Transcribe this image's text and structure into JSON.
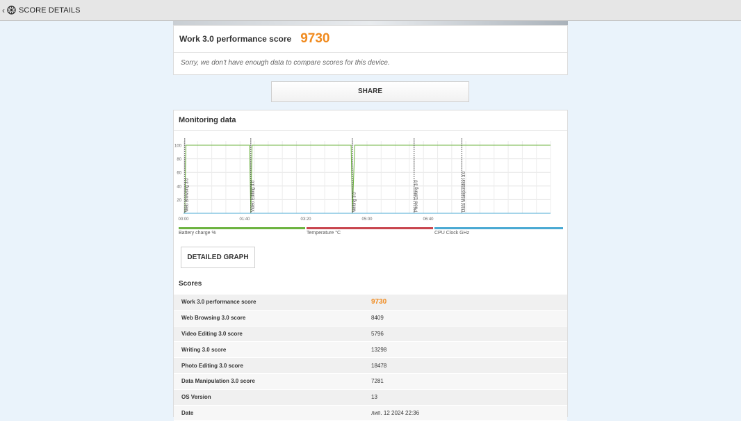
{
  "topbar": {
    "title": "SCORE DETAILS",
    "back_icon": "chevron-left-icon",
    "logo_icon": "app-logo-icon"
  },
  "score_card": {
    "title": "Work 3.0 performance score",
    "value": "9730",
    "note": "Sorry, we don't have enough data to compare scores for this device."
  },
  "share_label": "SHARE",
  "monitoring": {
    "title": "Monitoring data",
    "legend": [
      {
        "label": "Battery charge %",
        "color": "#6cb33f"
      },
      {
        "label": "Temperature °C",
        "color": "#c8454e"
      },
      {
        "label": "CPU Clock GHz",
        "color": "#4aa9d3"
      }
    ],
    "detailed_graph_label": "DETAILED GRAPH"
  },
  "chart_data": {
    "type": "line",
    "x_ticks": [
      "00:00",
      "01:40",
      "03:20",
      "05:00",
      "06:40"
    ],
    "y_ticks": [
      "100",
      "80",
      "60",
      "40",
      "20"
    ],
    "ylim": [
      0,
      100
    ],
    "x_unit": "seconds",
    "xlim": [
      0,
      480
    ],
    "grid": true,
    "markers": [
      {
        "label": "Web Browsing 3.0",
        "t": 2
      },
      {
        "label": "Video Editing 3.0",
        "t": 110
      },
      {
        "label": "Writing 3.0",
        "t": 276
      },
      {
        "label": "Photo Editing 3.0",
        "t": 377
      },
      {
        "label": "Data Manipulation 3.0",
        "t": 455
      }
    ],
    "series": [
      {
        "name": "Battery charge %",
        "color": "#6cb33f",
        "points": [
          [
            0,
            0
          ],
          [
            2,
            0
          ],
          [
            4,
            100
          ],
          [
            108,
            100
          ],
          [
            110,
            0
          ],
          [
            112,
            100
          ],
          [
            274,
            100
          ],
          [
            276,
            0
          ],
          [
            280,
            100
          ],
          [
            600,
            100
          ]
        ]
      },
      {
        "name": "CPU Clock GHz",
        "color": "#4aa9d3",
        "points": [
          [
            0,
            0
          ],
          [
            600,
            0
          ]
        ]
      }
    ]
  },
  "scores": {
    "title": "Scores",
    "rows": [
      {
        "label": "Work 3.0 performance score",
        "value": "9730"
      },
      {
        "label": "Web Browsing 3.0 score",
        "value": "8409"
      },
      {
        "label": "Video Editing 3.0 score",
        "value": "5796"
      },
      {
        "label": "Writing 3.0 score",
        "value": "13298"
      },
      {
        "label": "Photo Editing 3.0 score",
        "value": "18478"
      },
      {
        "label": "Data Manipulation 3.0 score",
        "value": "7281"
      },
      {
        "label": "OS Version",
        "value": "13"
      },
      {
        "label": "Date",
        "value": "лип. 12 2024 22:36"
      }
    ]
  }
}
